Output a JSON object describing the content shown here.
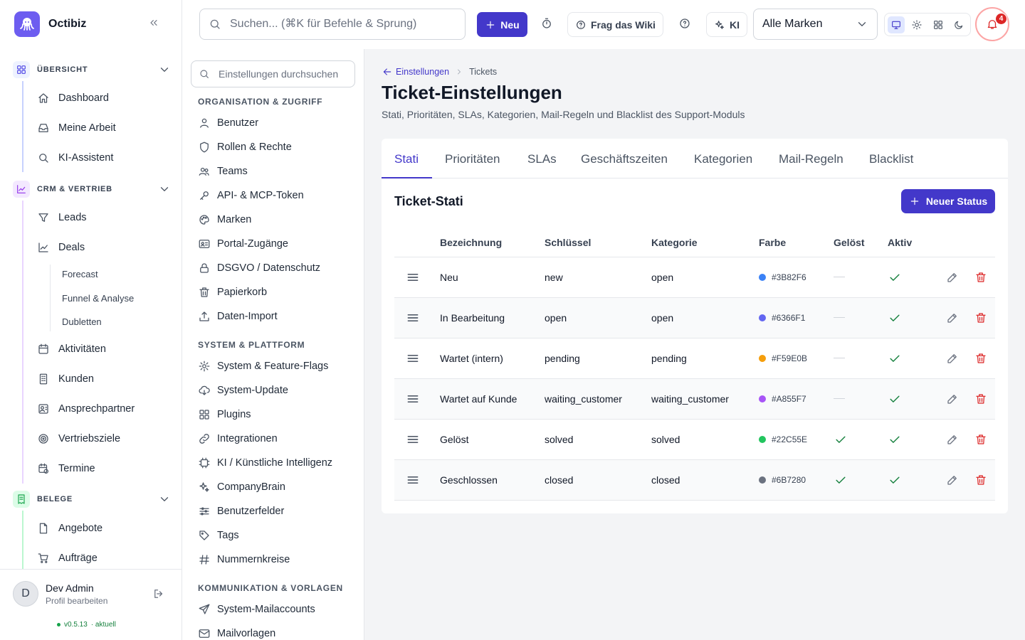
{
  "app": {
    "name": "Octibiz"
  },
  "sidebar": {
    "groups": [
      {
        "label": "ÜBERSICHT",
        "items": [
          "Dashboard",
          "Meine Arbeit",
          "KI-Assistent"
        ]
      },
      {
        "label": "CRM & VERTRIEB",
        "items": [
          "Leads",
          "Deals",
          "Aktivitäten",
          "Kunden",
          "Ansprechpartner",
          "Vertriebsziele",
          "Termine"
        ],
        "sub_items": [
          "Forecast",
          "Funnel & Analyse",
          "Dubletten"
        ]
      },
      {
        "label": "BELEGE",
        "items": [
          "Angebote",
          "Aufträge"
        ]
      }
    ],
    "user": {
      "name": "Dev Admin",
      "sub": "Profil bearbeiten",
      "initial": "D",
      "version": "v0.5.13",
      "version_status": "· aktuell"
    }
  },
  "topbar": {
    "search_placeholder": "Suchen... (⌘K für Befehle & Sprung)",
    "new_label": "Neu",
    "wiki_label": "Frag das Wiki",
    "ai_label": "KI",
    "brand_select": "Alle Marken",
    "notifications": "4"
  },
  "settings_nav": {
    "search_placeholder": "Einstellungen durchsuchen",
    "sections": [
      {
        "title": "ORGANISATION & ZUGRIFF",
        "items": [
          "Benutzer",
          "Rollen & Rechte",
          "Teams",
          "API- & MCP-Token",
          "Marken",
          "Portal-Zugänge",
          "DSGVO / Datenschutz",
          "Papierkorb",
          "Daten-Import"
        ]
      },
      {
        "title": "SYSTEM & PLATTFORM",
        "items": [
          "System & Feature-Flags",
          "System-Update",
          "Plugins",
          "Integrationen",
          "KI / Künstliche Intelligenz",
          "CompanyBrain",
          "Benutzerfelder",
          "Tags",
          "Nummernkreise"
        ]
      },
      {
        "title": "KOMMUNIKATION & VORLAGEN",
        "items": [
          "System-Mailaccounts",
          "Mailvorlagen"
        ]
      }
    ]
  },
  "main": {
    "breadcrumb": {
      "back": "Einstellungen",
      "current": "Tickets"
    },
    "title": "Ticket-Einstellungen",
    "subtitle": "Stati, Prioritäten, SLAs, Kategorien, Mail-Regeln und Blacklist des Support-Moduls",
    "tabs": [
      "Stati",
      "Prioritäten",
      "SLAs",
      "Geschäftszeiten",
      "Kategorien",
      "Mail-Regeln",
      "Blacklist"
    ],
    "active_tab": "Stati",
    "section_title": "Ticket-Stati",
    "new_status_label": "Neuer Status",
    "columns": [
      "Bezeichnung",
      "Schlüssel",
      "Kategorie",
      "Farbe",
      "Gelöst",
      "Aktiv"
    ],
    "rows": [
      {
        "name": "Neu",
        "key": "new",
        "category": "open",
        "color": "#3B82F6",
        "resolved": false,
        "active": true
      },
      {
        "name": "In Bearbeitung",
        "key": "open",
        "category": "open",
        "color": "#6366F1",
        "resolved": false,
        "active": true
      },
      {
        "name": "Wartet (intern)",
        "key": "pending",
        "category": "pending",
        "color": "#F59E0B",
        "resolved": false,
        "active": true
      },
      {
        "name": "Wartet auf Kunde",
        "key": "waiting_customer",
        "category": "waiting_customer",
        "color": "#A855F7",
        "resolved": false,
        "active": true
      },
      {
        "name": "Gelöst",
        "key": "solved",
        "category": "solved",
        "color": "#22C55E",
        "resolved": true,
        "active": true
      },
      {
        "name": "Geschlossen",
        "key": "closed",
        "category": "closed",
        "color": "#6B7280",
        "resolved": true,
        "active": true
      }
    ]
  }
}
